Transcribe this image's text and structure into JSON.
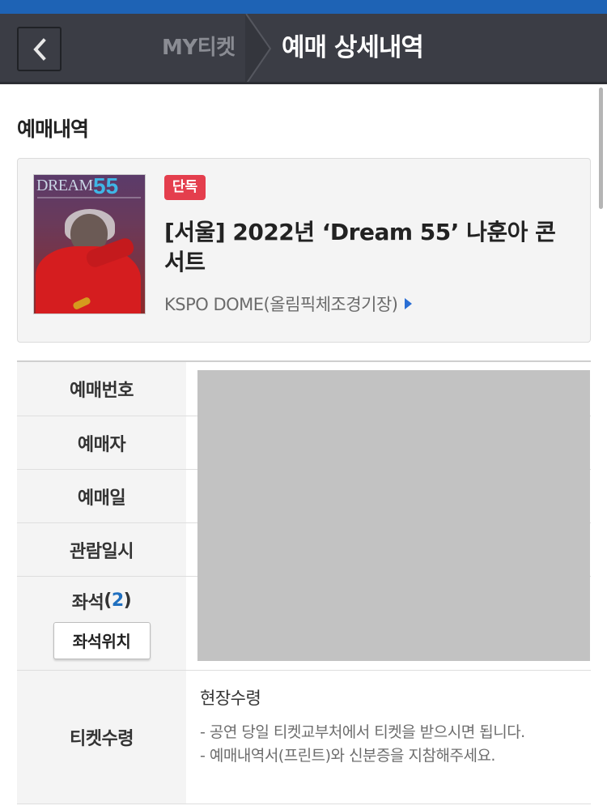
{
  "header": {
    "back_icon": "chevron-left-icon",
    "parent_label": "MY티켓",
    "title": "예매 상세내역",
    "colors": {
      "top_strip": "#1e63b5",
      "navbar": "#3b3d45"
    }
  },
  "section": {
    "title": "예매내역"
  },
  "event": {
    "poster": {
      "title_text": "DREAM",
      "title_number": "55"
    },
    "badge": "단독",
    "title": "[서울] 2022년 ‘Dream 55’ 나훈아 콘서트",
    "venue": "KSPO DOME(올림픽체조경기장)",
    "venue_arrow_icon": "caret-right-icon"
  },
  "details": {
    "rows": [
      {
        "label": "예매번호"
      },
      {
        "label": "예매자"
      },
      {
        "label": "예매일"
      },
      {
        "label": "관람일시"
      }
    ],
    "seat": {
      "label": "좌석",
      "count_open": "(",
      "count": "2",
      "count_close": ")",
      "button": "좌석위치"
    },
    "ticket_pickup": {
      "label": "티켓수령",
      "method": "현장수령",
      "notes": [
        "- 공연 당일 티켓교부처에서 티켓을 받으시면 됩니다.",
        "- 예매내역서(프린트)와 신분증을 지참해주세요."
      ]
    }
  }
}
